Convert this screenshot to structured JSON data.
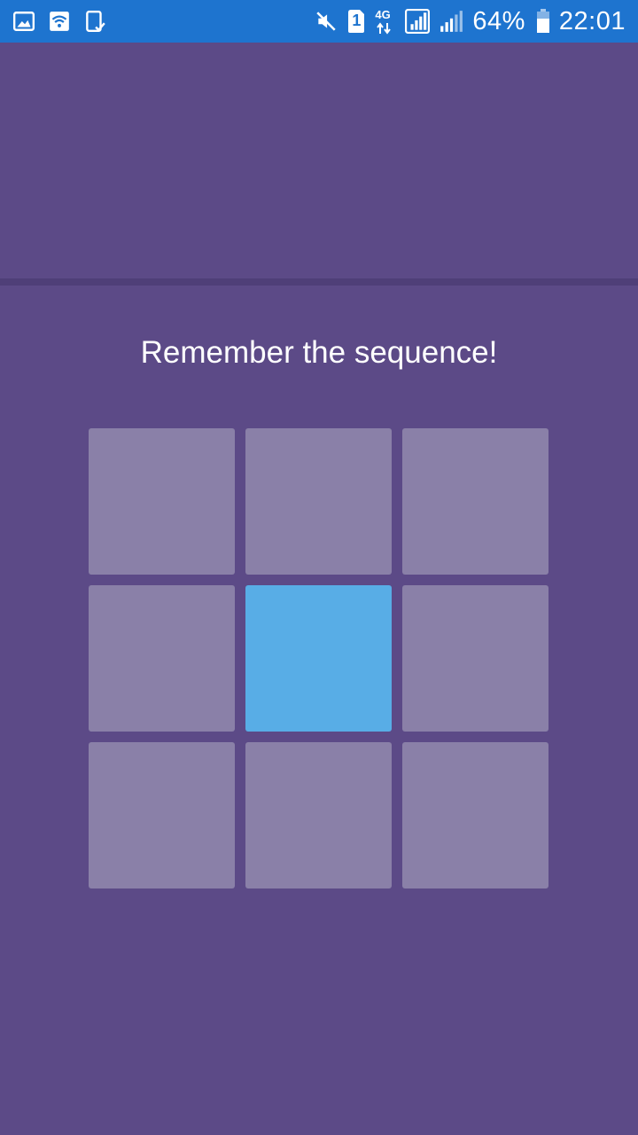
{
  "status_bar": {
    "left_icons": [
      "gallery-icon",
      "wifi-icon",
      "tablet-check-icon"
    ],
    "right_icons": [
      "mute-icon",
      "sim-1-icon",
      "4g-icon",
      "signal-icon",
      "signal-2-icon",
      "battery-icon"
    ],
    "network": "4G",
    "sim": "1",
    "battery": "64%",
    "time": "22:01"
  },
  "game": {
    "prompt": "Remember the sequence!",
    "grid_size": 3,
    "highlighted_tile_index": 4,
    "tile_color": "#8a80a8",
    "highlight_color": "#58ade6"
  },
  "colors": {
    "background": "#5c4a87",
    "status_bar": "#1e74cf",
    "divider": "#4f3f78"
  }
}
